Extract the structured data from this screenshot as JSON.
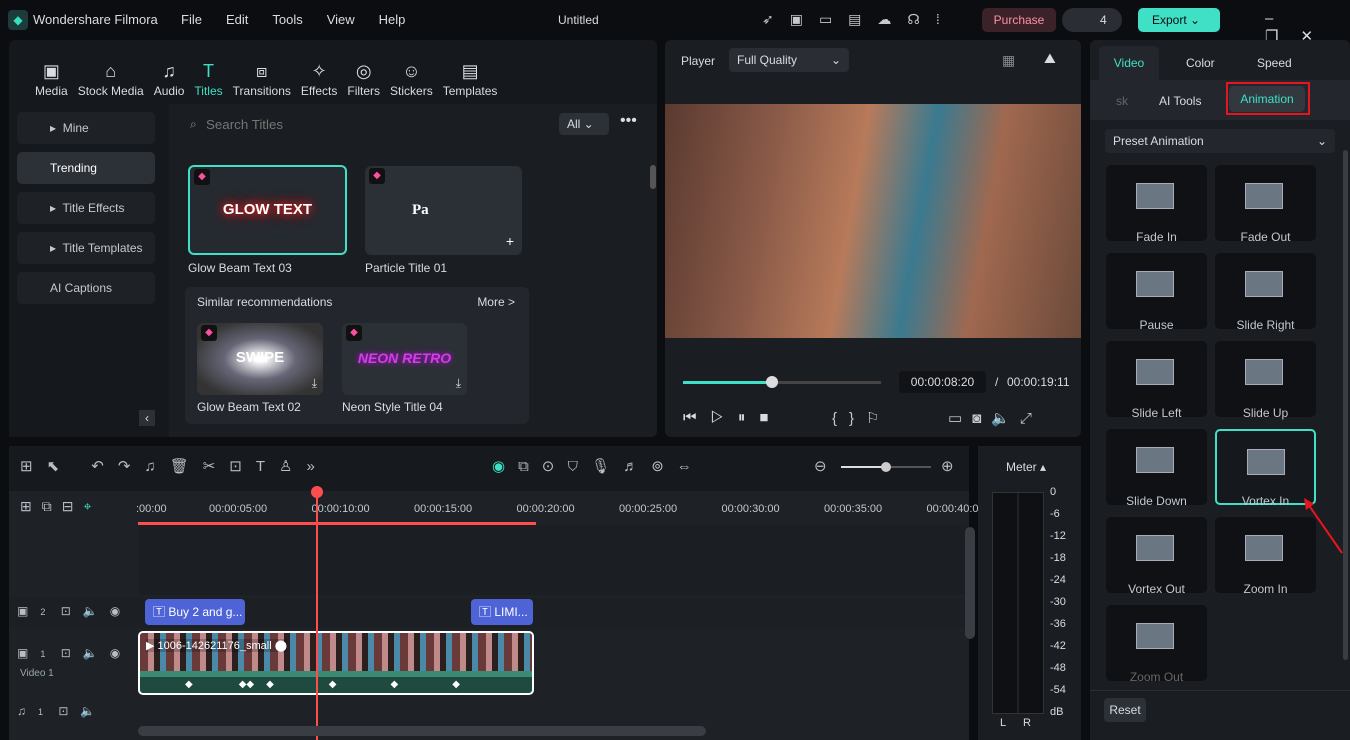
{
  "app": {
    "name": "Wondershare Filmora",
    "title": "Untitled",
    "menu": [
      "File",
      "Edit",
      "Tools",
      "View",
      "Help"
    ],
    "purchase": "Purchase",
    "credits": "4",
    "export": "Export"
  },
  "toolbar": [
    "Media",
    "Stock Media",
    "Audio",
    "Titles",
    "Transitions",
    "Effects",
    "Filters",
    "Stickers",
    "Templates"
  ],
  "active_tool": "Titles",
  "sidebar": [
    "Mine",
    "Trending",
    "Title Effects",
    "Title Templates",
    "AI Captions"
  ],
  "search": {
    "placeholder": "Search Titles",
    "filter": "All"
  },
  "titles": [
    {
      "name": "Glow Beam Text 03",
      "thumb": "GLOW TEXT"
    },
    {
      "name": "Particle Title 01",
      "thumb": "Pa"
    }
  ],
  "similar": {
    "heading": "Similar recommendations",
    "more": "More >",
    "items": [
      {
        "name": "Glow Beam Text 02",
        "thumb": "SWIPE"
      },
      {
        "name": "Neon Style Title 04",
        "thumb": "NEON RETRO"
      }
    ]
  },
  "player": {
    "label": "Player",
    "quality": "Full Quality",
    "current": "00:00:08:20",
    "sep": "/",
    "total": "00:00:19:11",
    "progress": 0.45
  },
  "right": {
    "tabs": [
      "Video",
      "Color",
      "Speed"
    ],
    "subtabs": [
      "sk",
      "AI Tools",
      "Animation"
    ],
    "preset": "Preset Animation",
    "animations": [
      "Fade In",
      "Fade Out",
      "Pause",
      "Slide Right",
      "Slide Left",
      "Slide Up",
      "Slide Down",
      "Vortex In",
      "Vortex Out",
      "Zoom In",
      "Zoom Out"
    ],
    "selected": "Vortex In",
    "reset": "Reset"
  },
  "timeline": {
    "ruler": [
      ":00:00",
      "00:00:05:00",
      "00:00:10:00",
      "00:00:15:00",
      "00:00:20:00",
      "00:00:25:00",
      "00:00:30:00",
      "00:00:35:00",
      "00:00:40:0"
    ],
    "tracks": {
      "t2": "2",
      "t1": "1",
      "video_label": "Video 1",
      "a1": "1"
    },
    "clips": {
      "title1": "Buy 2 and g...",
      "title2": "LIMI...",
      "video": "1006-142621176_small"
    }
  },
  "meter": {
    "label": "Meter ▴",
    "scale": [
      "0",
      "-6",
      "-12",
      "-18",
      "-24",
      "-30",
      "-36",
      "-42",
      "-48",
      "-54",
      "dB"
    ],
    "channels": [
      "L",
      "R"
    ]
  },
  "colors": {
    "accent": "#3fe0c5",
    "highlight": "#e8151f",
    "playhead": "#ff4d4f",
    "title_clip": "#4d63d6"
  }
}
